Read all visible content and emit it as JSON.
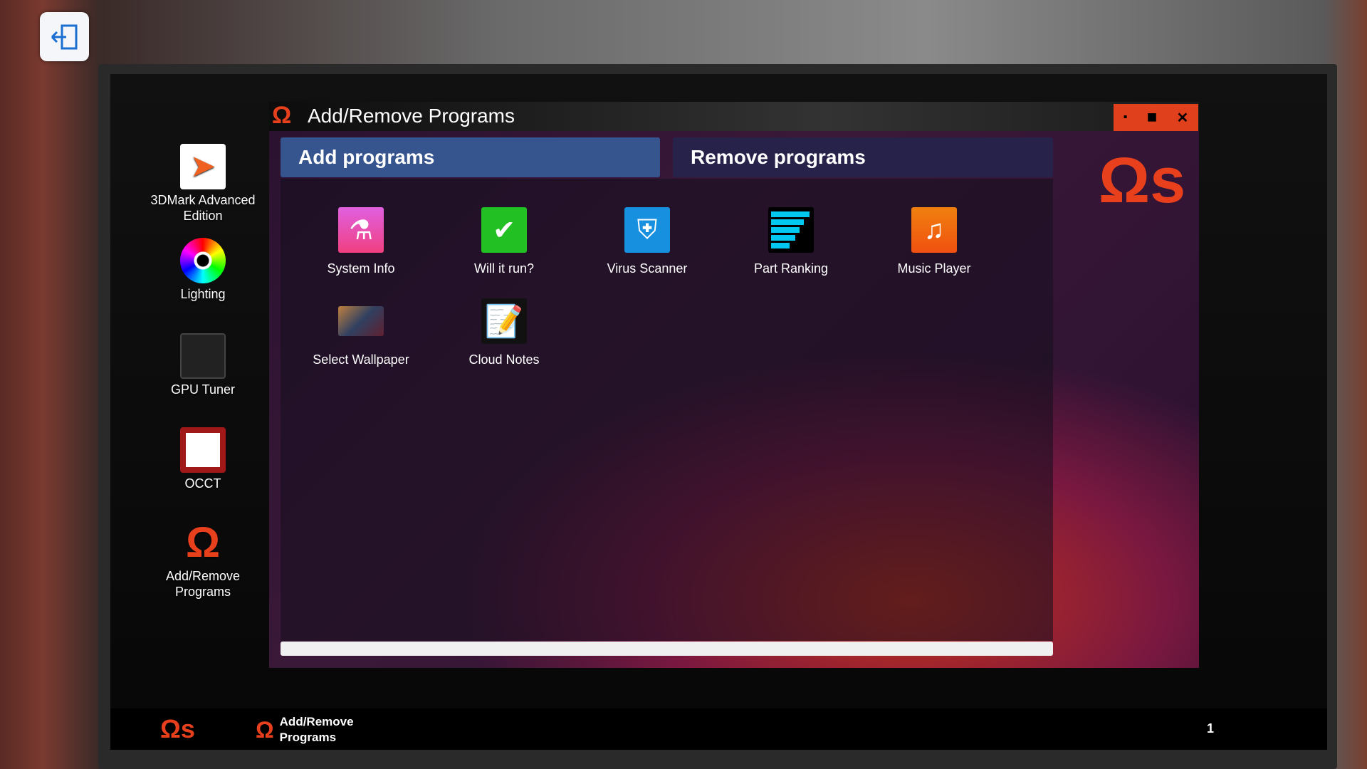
{
  "desktop": {
    "icons": [
      {
        "label": "3DMark Advanced Edition",
        "icon": "3dmark-icon"
      },
      {
        "label": "Lighting",
        "icon": "color-wheel-icon"
      },
      {
        "label": "GPU Tuner",
        "icon": "gpu-icon"
      },
      {
        "label": "OCCT",
        "icon": "occt-icon"
      },
      {
        "label": "Add/Remove Programs",
        "icon": "omega-icon"
      }
    ]
  },
  "window": {
    "title": "Add/Remove Programs",
    "logo": "Ωs",
    "tabs": {
      "add": "Add programs",
      "remove": "Remove programs"
    },
    "apps": [
      {
        "label": "System Info",
        "icon": "system-info-icon",
        "color": "#e040b0"
      },
      {
        "label": "Will it run?",
        "icon": "checkmark-icon",
        "color": "#22c022"
      },
      {
        "label": "Virus Scanner",
        "icon": "shield-icon",
        "color": "#1890e0"
      },
      {
        "label": "Part Ranking",
        "icon": "ranking-bars-icon",
        "color": "#00c8f0"
      },
      {
        "label": "Music Player",
        "icon": "music-note-icon",
        "color": "#f07010"
      },
      {
        "label": "Select Wallpaper",
        "icon": "wallpaper-icon"
      },
      {
        "label": "Cloud Notes",
        "icon": "notepad-icon"
      }
    ]
  },
  "taskbar": {
    "start": "Ωs",
    "open_program": "Add/Remove\nPrograms",
    "clock": "1"
  },
  "accent": "#e8401c"
}
